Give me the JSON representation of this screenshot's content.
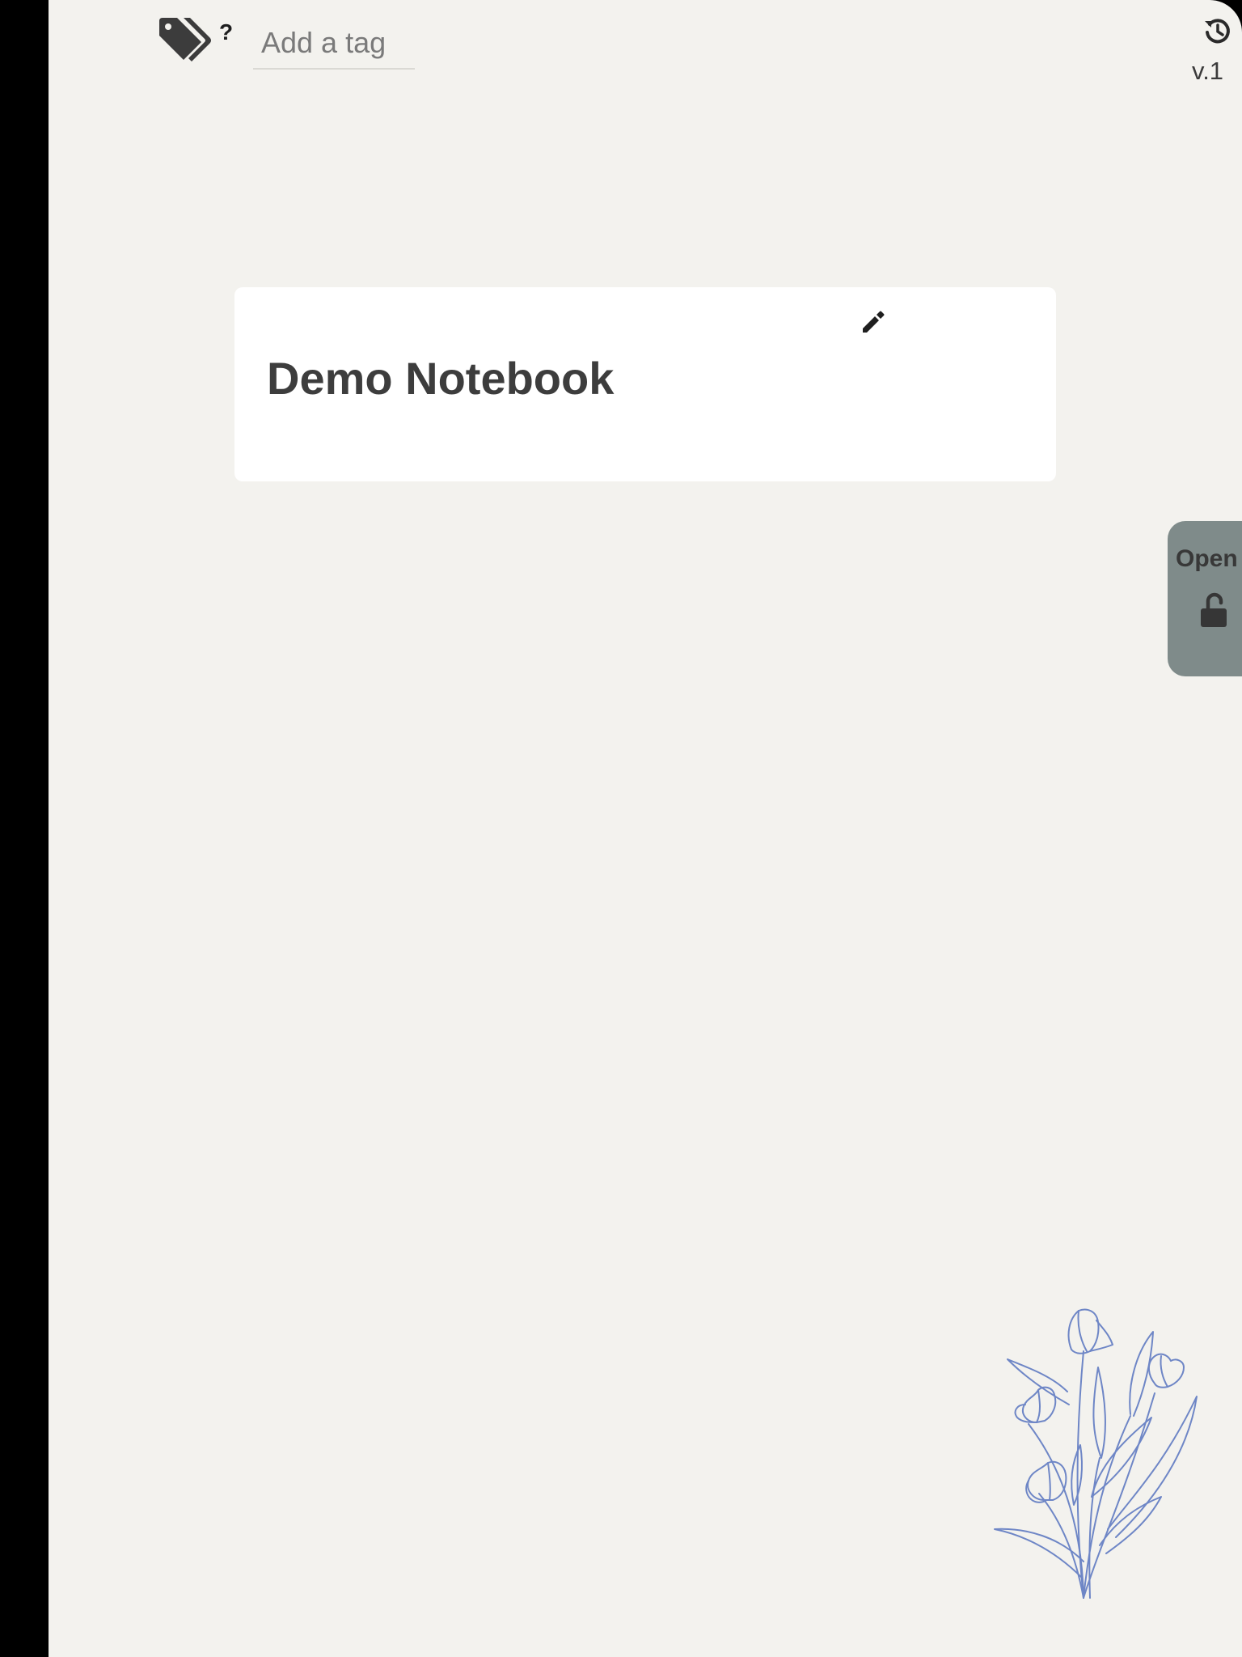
{
  "tags": {
    "help_label": "?",
    "input_placeholder": "Add a tag",
    "input_value": ""
  },
  "header": {
    "version_label": "v.1"
  },
  "notebook": {
    "title": "Demo Notebook"
  },
  "lock_tab": {
    "label": "Open"
  },
  "icons": {
    "tags": "tags-icon",
    "history": "history-icon",
    "edit": "pencil-icon",
    "lock": "unlocked-padlock-icon",
    "decoration": "tulip-bouquet-illustration"
  },
  "colors": {
    "cover_background": "#f3f2ee",
    "card_background": "#ffffff",
    "lock_tab_background": "#7f8b8a",
    "flower_line": "#6e86c6",
    "text_dark": "#3d3d3d"
  }
}
